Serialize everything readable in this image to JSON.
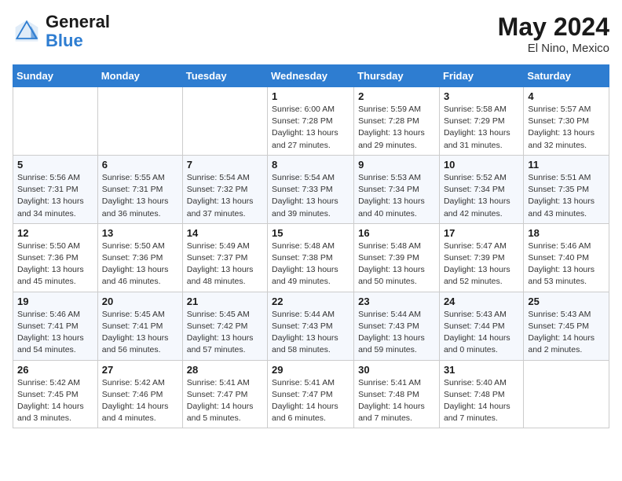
{
  "header": {
    "logo_text_general": "General",
    "logo_text_blue": "Blue",
    "month_title": "May 2024",
    "location": "El Nino, Mexico"
  },
  "days_of_week": [
    "Sunday",
    "Monday",
    "Tuesday",
    "Wednesday",
    "Thursday",
    "Friday",
    "Saturday"
  ],
  "weeks": [
    [
      {
        "day": "",
        "info": ""
      },
      {
        "day": "",
        "info": ""
      },
      {
        "day": "",
        "info": ""
      },
      {
        "day": "1",
        "info": "Sunrise: 6:00 AM\nSunset: 7:28 PM\nDaylight: 13 hours\nand 27 minutes."
      },
      {
        "day": "2",
        "info": "Sunrise: 5:59 AM\nSunset: 7:28 PM\nDaylight: 13 hours\nand 29 minutes."
      },
      {
        "day": "3",
        "info": "Sunrise: 5:58 AM\nSunset: 7:29 PM\nDaylight: 13 hours\nand 31 minutes."
      },
      {
        "day": "4",
        "info": "Sunrise: 5:57 AM\nSunset: 7:30 PM\nDaylight: 13 hours\nand 32 minutes."
      }
    ],
    [
      {
        "day": "5",
        "info": "Sunrise: 5:56 AM\nSunset: 7:31 PM\nDaylight: 13 hours\nand 34 minutes."
      },
      {
        "day": "6",
        "info": "Sunrise: 5:55 AM\nSunset: 7:31 PM\nDaylight: 13 hours\nand 36 minutes."
      },
      {
        "day": "7",
        "info": "Sunrise: 5:54 AM\nSunset: 7:32 PM\nDaylight: 13 hours\nand 37 minutes."
      },
      {
        "day": "8",
        "info": "Sunrise: 5:54 AM\nSunset: 7:33 PM\nDaylight: 13 hours\nand 39 minutes."
      },
      {
        "day": "9",
        "info": "Sunrise: 5:53 AM\nSunset: 7:34 PM\nDaylight: 13 hours\nand 40 minutes."
      },
      {
        "day": "10",
        "info": "Sunrise: 5:52 AM\nSunset: 7:34 PM\nDaylight: 13 hours\nand 42 minutes."
      },
      {
        "day": "11",
        "info": "Sunrise: 5:51 AM\nSunset: 7:35 PM\nDaylight: 13 hours\nand 43 minutes."
      }
    ],
    [
      {
        "day": "12",
        "info": "Sunrise: 5:50 AM\nSunset: 7:36 PM\nDaylight: 13 hours\nand 45 minutes."
      },
      {
        "day": "13",
        "info": "Sunrise: 5:50 AM\nSunset: 7:36 PM\nDaylight: 13 hours\nand 46 minutes."
      },
      {
        "day": "14",
        "info": "Sunrise: 5:49 AM\nSunset: 7:37 PM\nDaylight: 13 hours\nand 48 minutes."
      },
      {
        "day": "15",
        "info": "Sunrise: 5:48 AM\nSunset: 7:38 PM\nDaylight: 13 hours\nand 49 minutes."
      },
      {
        "day": "16",
        "info": "Sunrise: 5:48 AM\nSunset: 7:39 PM\nDaylight: 13 hours\nand 50 minutes."
      },
      {
        "day": "17",
        "info": "Sunrise: 5:47 AM\nSunset: 7:39 PM\nDaylight: 13 hours\nand 52 minutes."
      },
      {
        "day": "18",
        "info": "Sunrise: 5:46 AM\nSunset: 7:40 PM\nDaylight: 13 hours\nand 53 minutes."
      }
    ],
    [
      {
        "day": "19",
        "info": "Sunrise: 5:46 AM\nSunset: 7:41 PM\nDaylight: 13 hours\nand 54 minutes."
      },
      {
        "day": "20",
        "info": "Sunrise: 5:45 AM\nSunset: 7:41 PM\nDaylight: 13 hours\nand 56 minutes."
      },
      {
        "day": "21",
        "info": "Sunrise: 5:45 AM\nSunset: 7:42 PM\nDaylight: 13 hours\nand 57 minutes."
      },
      {
        "day": "22",
        "info": "Sunrise: 5:44 AM\nSunset: 7:43 PM\nDaylight: 13 hours\nand 58 minutes."
      },
      {
        "day": "23",
        "info": "Sunrise: 5:44 AM\nSunset: 7:43 PM\nDaylight: 13 hours\nand 59 minutes."
      },
      {
        "day": "24",
        "info": "Sunrise: 5:43 AM\nSunset: 7:44 PM\nDaylight: 14 hours\nand 0 minutes."
      },
      {
        "day": "25",
        "info": "Sunrise: 5:43 AM\nSunset: 7:45 PM\nDaylight: 14 hours\nand 2 minutes."
      }
    ],
    [
      {
        "day": "26",
        "info": "Sunrise: 5:42 AM\nSunset: 7:45 PM\nDaylight: 14 hours\nand 3 minutes."
      },
      {
        "day": "27",
        "info": "Sunrise: 5:42 AM\nSunset: 7:46 PM\nDaylight: 14 hours\nand 4 minutes."
      },
      {
        "day": "28",
        "info": "Sunrise: 5:41 AM\nSunset: 7:47 PM\nDaylight: 14 hours\nand 5 minutes."
      },
      {
        "day": "29",
        "info": "Sunrise: 5:41 AM\nSunset: 7:47 PM\nDaylight: 14 hours\nand 6 minutes."
      },
      {
        "day": "30",
        "info": "Sunrise: 5:41 AM\nSunset: 7:48 PM\nDaylight: 14 hours\nand 7 minutes."
      },
      {
        "day": "31",
        "info": "Sunrise: 5:40 AM\nSunset: 7:48 PM\nDaylight: 14 hours\nand 7 minutes."
      },
      {
        "day": "",
        "info": ""
      }
    ]
  ]
}
